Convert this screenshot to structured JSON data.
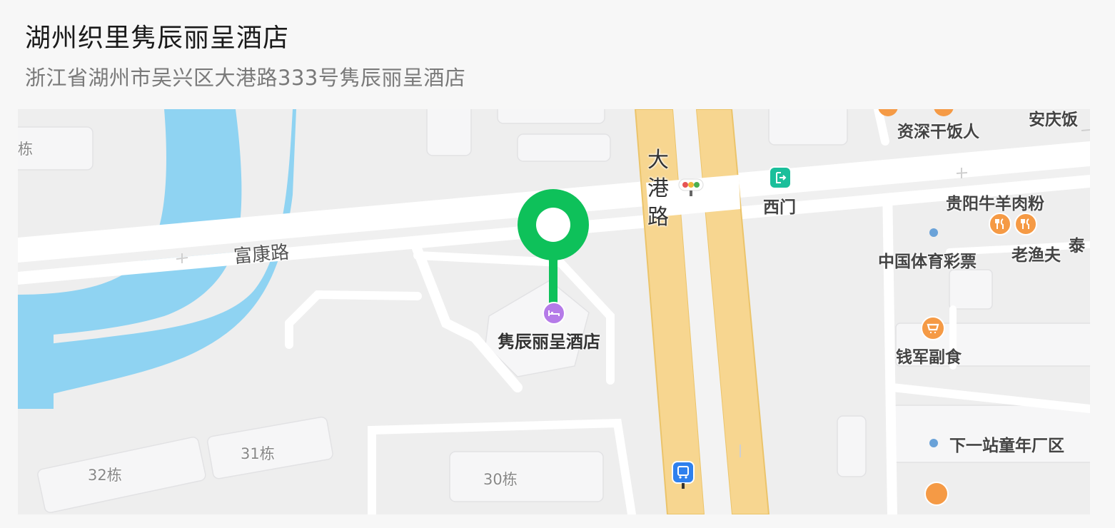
{
  "place": {
    "name": "湖州织里隽辰丽呈酒店",
    "address": "浙江省湖州市吴兴区大港路333号隽辰丽呈酒店"
  },
  "map": {
    "roads": {
      "fukang": "富康路",
      "dagang": "大港路"
    },
    "buildings": {
      "b_edge": "栋",
      "b31": "31栋",
      "b32": "32栋",
      "b30": "30栋"
    },
    "pois": {
      "hotel": "隽辰丽呈酒店",
      "west_gate": "西门",
      "zishen": "资深干饭人",
      "anqing": "安庆饭",
      "guiyang": "贵阳牛羊肉粉",
      "lottery": "中国体育彩票",
      "laoyufu": "老渔夫",
      "tai": "泰",
      "qianjun": "钱军副食",
      "xiayizhan": "下一站童年厂区"
    },
    "colors": {
      "water": "#8fd3f2",
      "main_road": "#f7d690",
      "pin": "#0ec15a",
      "hotel_icon": "#b57be8",
      "food_icon": "#f59a45"
    },
    "icons": {
      "pin": "location-pin-icon",
      "hotel": "bed-icon",
      "gate": "exit-icon",
      "traffic": "traffic-light-icon",
      "bus": "bus-stop-icon",
      "food": "fork-knife-icon",
      "shop": "shopping-cart-icon"
    }
  }
}
